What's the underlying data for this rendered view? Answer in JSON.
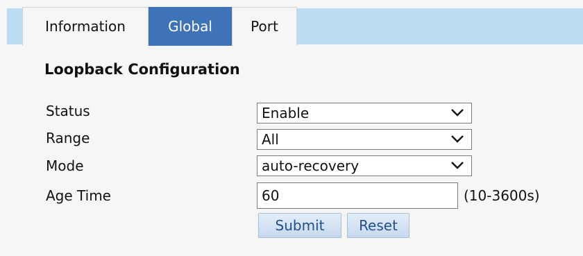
{
  "tabs": [
    {
      "label": "Information",
      "active": false
    },
    {
      "label": "Global",
      "active": true
    },
    {
      "label": "Port",
      "active": false
    }
  ],
  "section": {
    "title": "Loopback Configuration"
  },
  "form": {
    "status": {
      "label": "Status",
      "value": "Enable"
    },
    "range": {
      "label": "Range",
      "value": "All"
    },
    "mode": {
      "label": "Mode",
      "value": "auto-recovery"
    },
    "age_time": {
      "label": "Age Time",
      "value": "60",
      "hint": "(10-3600s)"
    }
  },
  "buttons": {
    "submit": "Submit",
    "reset": "Reset"
  },
  "colors": {
    "tab_strip": "#bcdcf1",
    "active_tab": "#3e74b7",
    "background": "#f6f6f6"
  },
  "icons": {
    "dropdown": "chevron-down-icon"
  }
}
